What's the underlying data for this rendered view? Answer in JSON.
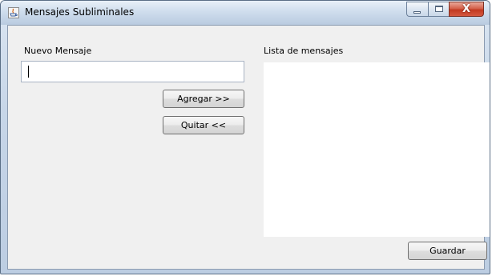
{
  "window": {
    "title": "Mensajes Subliminales",
    "controls": {
      "minimize_icon": "minimize-icon",
      "maximize_icon": "maximize-icon",
      "close_glyph": "X"
    }
  },
  "form": {
    "new_message_label": "Nuevo Mensaje",
    "new_message_value": "",
    "add_button": "Agregar >>",
    "remove_button": "Quitar <<",
    "list_label": "Lista de mensajes",
    "list_items": [],
    "save_button": "Guardar"
  },
  "colors": {
    "titlebar": "#cfdded",
    "client_bg": "#f0f0f0",
    "close_button": "#c23a22"
  }
}
